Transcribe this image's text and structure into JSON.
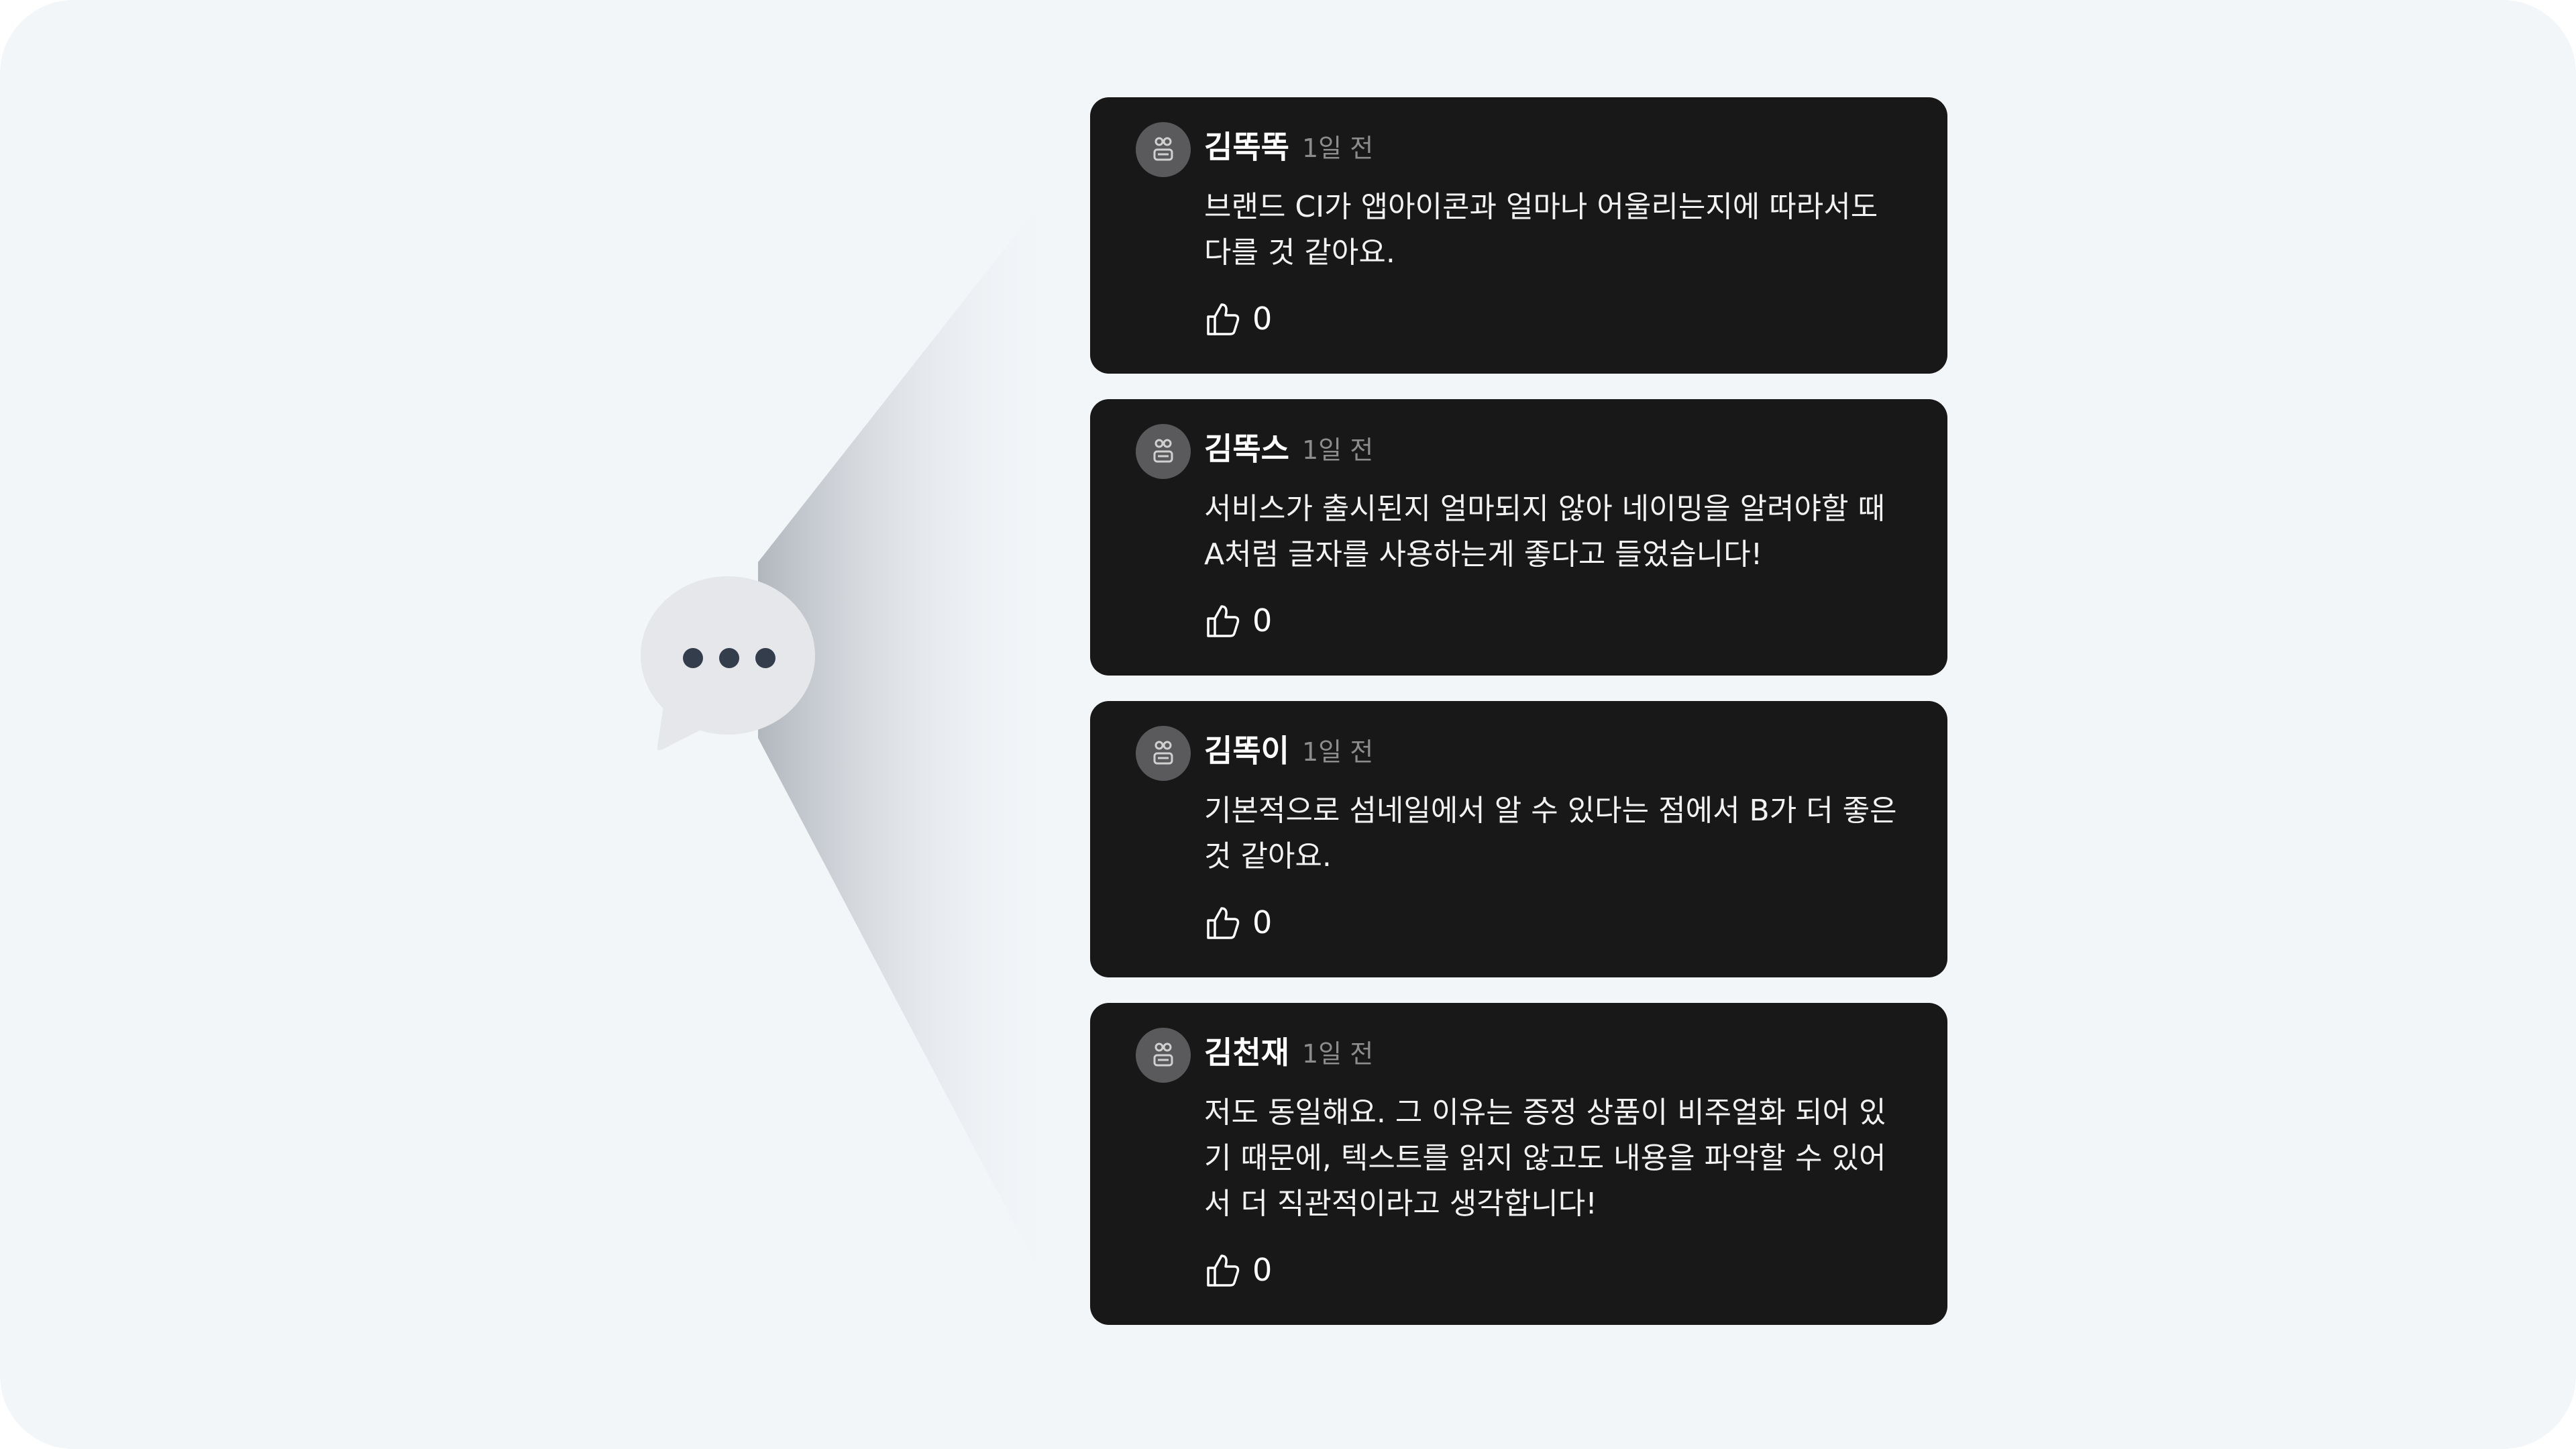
{
  "colors": {
    "background": "#f3f6f9",
    "card": "#181818",
    "bubble": "#e5e7ea",
    "dots": "#333d4b",
    "time_text": "#8c8c8c"
  },
  "icons": {
    "avatar": "robot-face-icon",
    "like": "thumbs-up-icon",
    "bubble": "chat-bubble-ellipsis-icon"
  },
  "comments": [
    {
      "author": "김똑똑",
      "time": "1일 전",
      "lines": [
        "브랜드 CI가 앱아이콘과 얼마나 어울리는지에 따라서도",
        "다를 것 같아요."
      ],
      "likes": "0"
    },
    {
      "author": "김똑스",
      "time": "1일 전",
      "lines": [
        "서비스가 출시된지 얼마되지 않아 네이밍을 알려야할 때",
        "A처럼 글자를 사용하는게 좋다고 들었습니다!"
      ],
      "likes": "0"
    },
    {
      "author": "김똑이",
      "time": "1일 전",
      "lines": [
        "기본적으로 섬네일에서 알 수 있다는 점에서 B가 더 좋은",
        "것 같아요."
      ],
      "likes": "0"
    },
    {
      "author": "김천재",
      "time": "1일 전",
      "lines": [
        "저도 동일해요. 그 이유는 증정 상품이 비주얼화 되어 있",
        "기 때문에, 텍스트를 읽지 않고도 내용을 파악할 수 있어",
        "서 더 직관적이라고 생각합니다!"
      ],
      "likes": "0"
    }
  ]
}
